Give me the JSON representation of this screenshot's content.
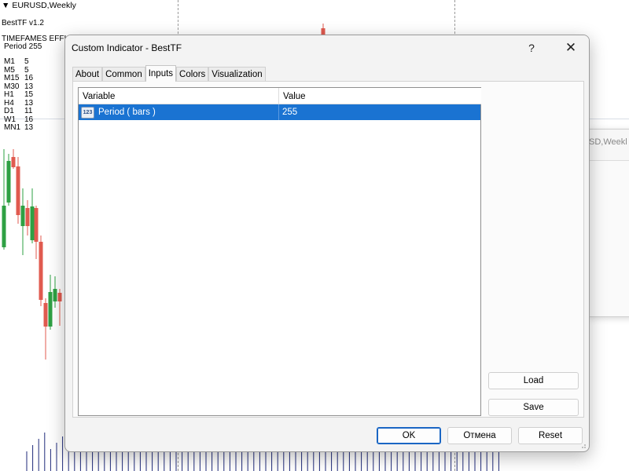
{
  "chart": {
    "symbol": "EURUSD,Weekly",
    "indicator_name": "BestTF v1.2",
    "efficiency_heading": "TIMEFAMES EFFIC",
    "period_label": "Period 255",
    "timeframes": [
      {
        "tf": "M1",
        "value": "5"
      },
      {
        "tf": "M5",
        "value": "5"
      },
      {
        "tf": "M15",
        "value": "16"
      },
      {
        "tf": "M30",
        "value": "13"
      },
      {
        "tf": "H1",
        "value": "15"
      },
      {
        "tf": "H4",
        "value": "13"
      },
      {
        "tf": "D1",
        "value": "11"
      },
      {
        "tf": "W1",
        "value": "16"
      },
      {
        "tf": "MN1",
        "value": "13"
      }
    ],
    "bull_color": "#2ea043",
    "bear_color": "#e05a4f",
    "volume_color": "#1f2a7a"
  },
  "background_window": {
    "title_fragment": "SD,Weekl"
  },
  "dialog": {
    "title": "Custom Indicator - BestTF",
    "help_label": "?",
    "close_label": "✕",
    "tabs": [
      {
        "label": "About",
        "active": false
      },
      {
        "label": "Common",
        "active": false
      },
      {
        "label": "Inputs",
        "active": true
      },
      {
        "label": "Colors",
        "active": false
      },
      {
        "label": "Visualization",
        "active": false
      }
    ],
    "grid": {
      "columns": {
        "variable": "Variable",
        "value": "Value"
      },
      "rows": [
        {
          "type_icon_text": "123",
          "variable": "Period ( bars )",
          "value": "255",
          "selected": true
        }
      ]
    },
    "buttons": {
      "load": "Load",
      "save": "Save",
      "ok": "OK",
      "cancel": "Отмена",
      "reset": "Reset"
    },
    "accent_color": "#1a73d2"
  }
}
